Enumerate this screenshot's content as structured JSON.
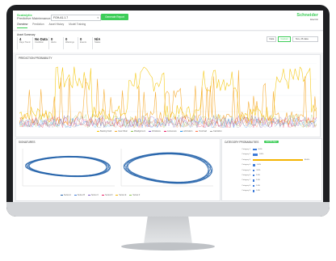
{
  "app": {
    "brand_line1": "Scatalytix",
    "brand_line2": "Predictive Maintenance",
    "asset_value": "FGH-A1.1.7",
    "report_button": "Generate Report",
    "vendor_name": "Schneider",
    "vendor_sub": "Electric"
  },
  "tabs": [
    "Overview",
    "Prediction",
    "Asset History",
    "Model Training"
  ],
  "kpi": {
    "header": "Asset Summary",
    "cards": [
      {
        "value": "4",
        "label": "Days Trend"
      },
      {
        "value": "No Data",
        "label": "Condition"
      },
      {
        "value": "0",
        "label": "Alerts"
      },
      {
        "value": "0",
        "label": "Warnings"
      },
      {
        "value": "0",
        "label": "Events"
      },
      {
        "value": "N/A",
        "label": "Status"
      }
    ],
    "controls": [
      "Data",
      "Custom"
    ],
    "date_value": "Nov, 26 data"
  },
  "chart_panel": {
    "title": "PREDICTION PROBABILITY",
    "legend": [
      "Bearing Fault",
      "Gear Wear",
      "Misalignment",
      "Imbalance",
      "Looseness",
      "Lubrication",
      "Overload",
      "Cavitation"
    ],
    "colors": [
      "#f4c400",
      "#f5a623",
      "#8bc34a",
      "#7e57c2",
      "#e91e63",
      "#2196f3",
      "#ff7043",
      "#9e9e9e"
    ]
  },
  "loops_panel": {
    "title": "SIGNATURES",
    "legend": [
      "Series A",
      "Series B",
      "Series C",
      "Series D",
      "Series E",
      "Series F"
    ],
    "line_color": "#1f5fa8"
  },
  "dist_panel": {
    "title": "CATEGORY PROBABILITIES",
    "badge": "Last 30 days",
    "accent_color": "#f4b400",
    "bar_color": "#3d7bd9",
    "bars": [
      {
        "label": "Category 1",
        "value": 6,
        "text": "6.0%"
      },
      {
        "label": "Category 2",
        "value": 8,
        "text": "8.0%"
      },
      {
        "label": "Category 3",
        "value": 80,
        "text": "80.0%"
      },
      {
        "label": "Category 4",
        "value": 4,
        "text": "4.0%"
      },
      {
        "label": "Category 5",
        "value": 3,
        "text": "3.0%"
      },
      {
        "label": "Category 6",
        "value": 2,
        "text": "2.0%"
      },
      {
        "label": "Category 7",
        "value": 2,
        "text": "2.0%"
      },
      {
        "label": "Category 8",
        "value": 1,
        "text": "1.0%"
      },
      {
        "label": "Category 9",
        "value": 1,
        "text": "1.0%"
      }
    ]
  }
}
